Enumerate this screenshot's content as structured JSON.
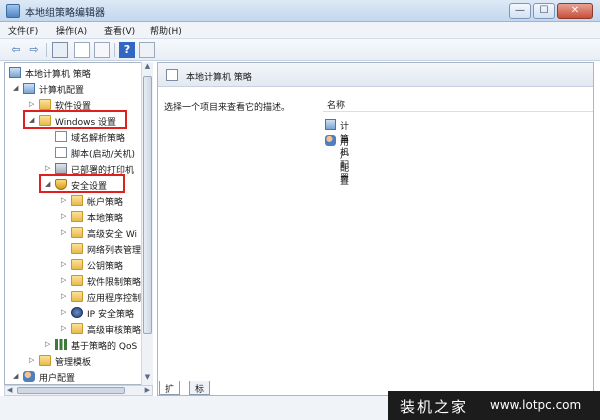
{
  "window": {
    "title": "本地组策略编辑器",
    "min_label": "—",
    "max_label": "☐",
    "close_label": "✕"
  },
  "menu": [
    "文件(F)",
    "操作(A)",
    "查看(V)",
    "帮助(H)"
  ],
  "toolbar": {
    "back": "⇦",
    "forward": "⇨",
    "help": "?"
  },
  "tree": [
    {
      "label": "本地计算机 策略",
      "icon": "computer-icon"
    },
    {
      "label": "计算机配置",
      "icon": "computer-icon"
    },
    {
      "label": "软件设置",
      "icon": "folder-icon"
    },
    {
      "label": "Windows 设置",
      "icon": "folder-icon"
    },
    {
      "label": "域名解析策略",
      "icon": "doc-icon"
    },
    {
      "label": "脚本(启动/关机)",
      "icon": "doc-icon"
    },
    {
      "label": "已部署的打印机",
      "icon": "printer-icon"
    },
    {
      "label": "安全设置",
      "icon": "shield-icon"
    },
    {
      "label": "帐户策略",
      "icon": "folder-icon"
    },
    {
      "label": "本地策略",
      "icon": "folder-icon"
    },
    {
      "label": "高级安全 Wi",
      "icon": "folder-icon"
    },
    {
      "label": "网络列表管理",
      "icon": "folder-icon"
    },
    {
      "label": "公钥策略",
      "icon": "folder-icon"
    },
    {
      "label": "软件限制策略",
      "icon": "folder-icon"
    },
    {
      "label": "应用程序控制",
      "icon": "folder-icon"
    },
    {
      "label": "IP 安全策略",
      "icon": "ip-icon"
    },
    {
      "label": "高级审核策略",
      "icon": "folder-icon"
    },
    {
      "label": "基于策略的 QoS",
      "icon": "bars-icon"
    },
    {
      "label": "管理模板",
      "icon": "folder-icon"
    },
    {
      "label": "用户配置",
      "icon": "users-icon"
    }
  ],
  "right": {
    "header": "本地计算机 策略",
    "description": "选择一个项目来查看它的描述。",
    "column": "名称",
    "items": [
      {
        "label": "计算机配置",
        "icon": "computer-icon"
      },
      {
        "label": "用户配置",
        "icon": "users-icon"
      }
    ]
  },
  "tabs": [
    "扩展",
    "标准"
  ],
  "watermark": {
    "brand": "装机之家",
    "url": "www.lotpc.com"
  }
}
